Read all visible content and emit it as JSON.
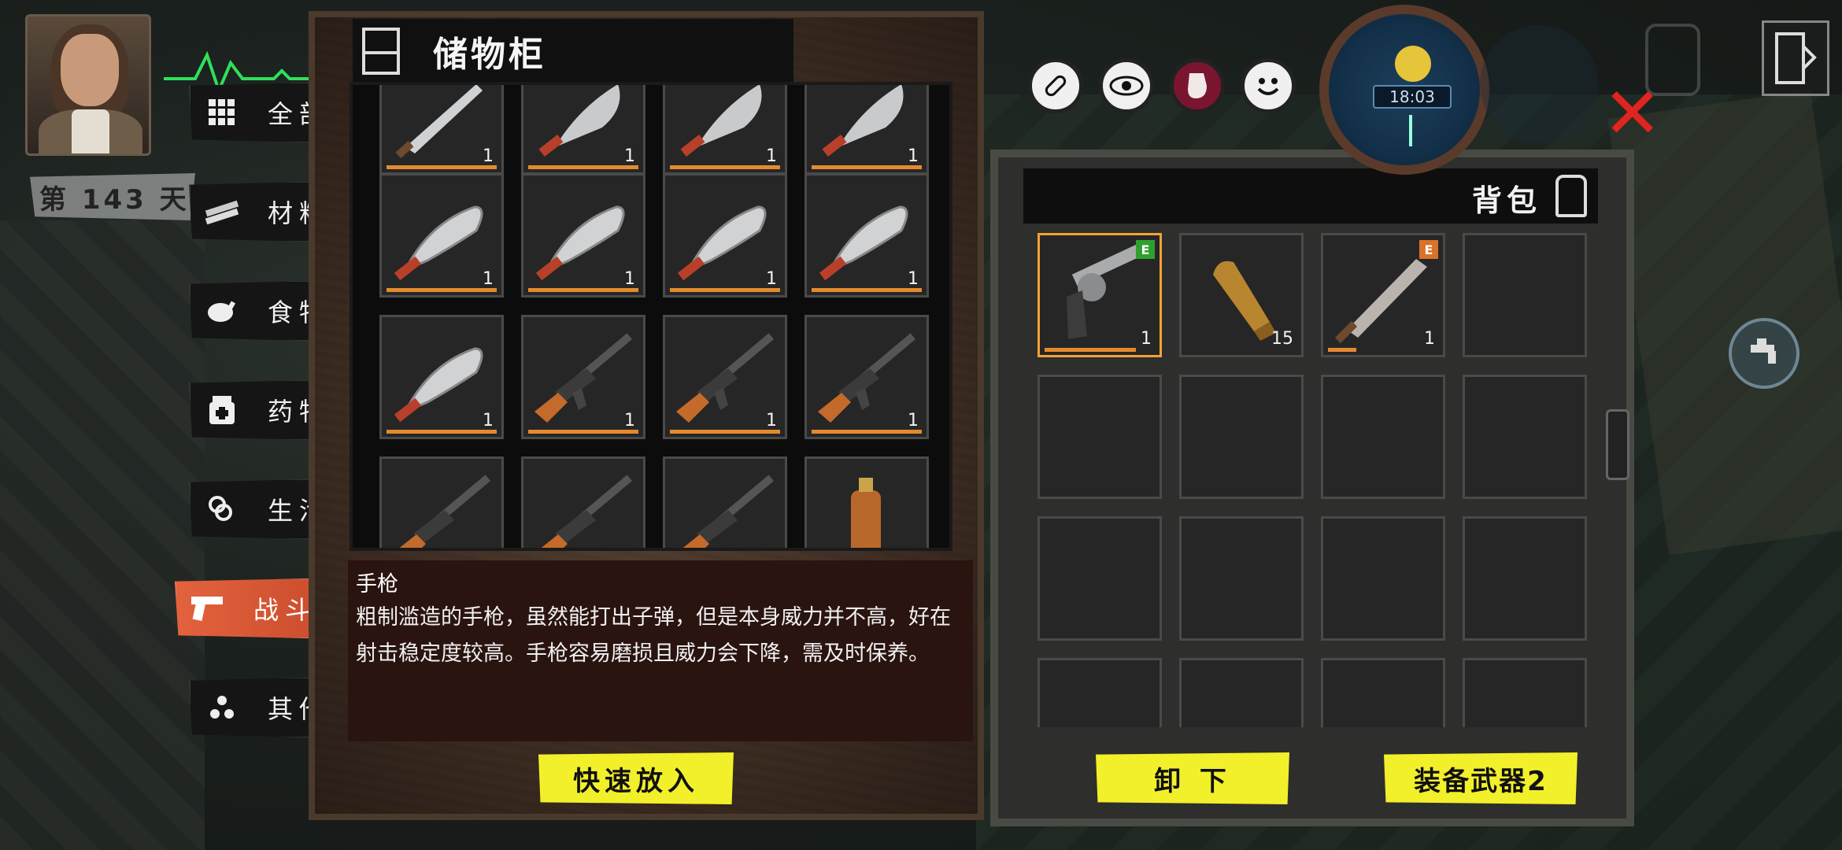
{
  "hud": {
    "day_label": "第 143 天",
    "clock_time": "18:03"
  },
  "categories": [
    {
      "label": "全部",
      "icon": "grid-icon"
    },
    {
      "label": "材料",
      "icon": "planks-icon"
    },
    {
      "label": "食物",
      "icon": "chicken-icon"
    },
    {
      "label": "药物",
      "icon": "medicine-icon"
    },
    {
      "label": "生活",
      "icon": "rope-icon"
    },
    {
      "label": "战斗",
      "icon": "pistol-icon",
      "active": true
    },
    {
      "label": "其他",
      "icon": "dots-icon"
    }
  ],
  "storage": {
    "title": "储物柜",
    "items": [
      {
        "name": "machete",
        "qty": "1"
      },
      {
        "name": "kukri",
        "qty": "1"
      },
      {
        "name": "kukri",
        "qty": "1"
      },
      {
        "name": "kukri",
        "qty": "1"
      },
      {
        "name": "kukri",
        "qty": "1"
      },
      {
        "name": "kukri",
        "qty": "1"
      },
      {
        "name": "kukri",
        "qty": "1"
      },
      {
        "name": "kukri",
        "qty": "1"
      },
      {
        "name": "kukri",
        "qty": "1"
      },
      {
        "name": "ak-rifle",
        "qty": "1"
      },
      {
        "name": "ak-rifle",
        "qty": "1"
      },
      {
        "name": "ak-rifle",
        "qty": "1"
      },
      {
        "name": "ak-rifle",
        "qty": ""
      },
      {
        "name": "ak-rifle",
        "qty": ""
      },
      {
        "name": "ak-rifle",
        "qty": ""
      },
      {
        "name": "gas-canister",
        "qty": ""
      }
    ],
    "description_title": "手枪",
    "description_text": "粗制滥造的手枪，虽然能打出子弹，但是本身威力并不高，好在射击稳定度较高。手枪容易磨损且威力会下降，需及时保养。",
    "quick_put_label": "快速放入"
  },
  "backpack": {
    "title": "背包",
    "items": [
      {
        "name": "revolver",
        "qty": "1",
        "tag": "E",
        "tag_color": "#2fa02f",
        "selected": true
      },
      {
        "name": "bullet",
        "qty": "15"
      },
      {
        "name": "saw-machete",
        "qty": "1",
        "tag": "E",
        "tag_color": "#d9722b"
      },
      {
        "name": "",
        "qty": ""
      }
    ],
    "unload_label": "卸 下",
    "equip_label": "装备武器2"
  },
  "colors": {
    "accent_orange": "#e3623e",
    "button_yellow": "#f2f02a",
    "close_red": "#e0241f"
  }
}
